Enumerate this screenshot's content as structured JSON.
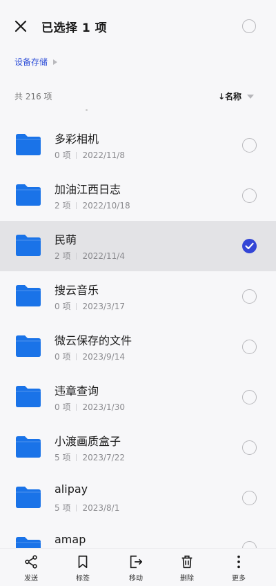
{
  "header": {
    "title": "已选择 1 项"
  },
  "breadcrumb": {
    "label": "设备存储"
  },
  "list_header": {
    "count": "共 216 项",
    "sort": "↓名称"
  },
  "items": [
    {
      "name": "多彩相机",
      "count": "0 项",
      "date": "2022/11/8",
      "selected": false
    },
    {
      "name": "加油江西日志",
      "count": "2 项",
      "date": "2022/10/18",
      "selected": false
    },
    {
      "name": "民萌",
      "count": "2 项",
      "date": "2022/11/4",
      "selected": true
    },
    {
      "name": "搜云音乐",
      "count": "0 项",
      "date": "2023/3/17",
      "selected": false
    },
    {
      "name": "微云保存的文件",
      "count": "0 项",
      "date": "2023/9/14",
      "selected": false
    },
    {
      "name": "违章查询",
      "count": "0 项",
      "date": "2023/1/30",
      "selected": false
    },
    {
      "name": "小渡画质盒子",
      "count": "5 项",
      "date": "2023/7/22",
      "selected": false
    },
    {
      "name": "alipay",
      "count": "5 项",
      "date": "2023/8/1",
      "selected": false
    },
    {
      "name": "amap",
      "count": "",
      "date": "",
      "selected": false
    }
  ],
  "toolbar": {
    "send": "发送",
    "tag": "标签",
    "move": "移动",
    "delete": "删除",
    "more": "更多"
  },
  "colors": {
    "accent": "#3446d6",
    "folder": "#1a73e8",
    "link": "#2f4fd8",
    "selected_row": "#e3e3e6"
  },
  "icons": [
    "close-icon",
    "chevron-right-icon",
    "sort-caret-icon",
    "folder-icon",
    "check-icon",
    "share-icon",
    "bookmark-icon",
    "move-icon",
    "trash-icon",
    "more-vertical-icon"
  ]
}
